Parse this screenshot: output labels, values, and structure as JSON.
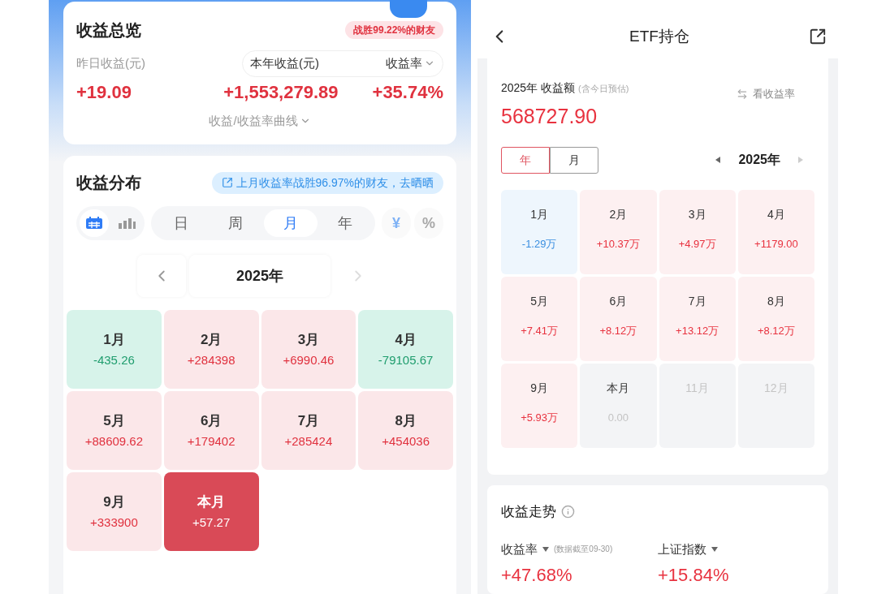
{
  "left": {
    "overview": {
      "title": "收益总览",
      "badge": "战胜99.22%的财友",
      "yesterday_label": "昨日收益(元)",
      "year_label": "本年收益(元)",
      "rate_label": "收益率",
      "yesterday_value": "+19.09",
      "year_value": "+1,553,279.89",
      "rate_value": "+35.74%",
      "curve_toggle": "收益/收益率曲线"
    },
    "distribution": {
      "title": "收益分布",
      "share_banner": "上月收益率战胜96.97%的财友，去晒晒",
      "views": [
        {
          "kind": "calendar",
          "selected": true
        },
        {
          "kind": "bars",
          "selected": false
        }
      ],
      "periods": [
        {
          "label": "日",
          "selected": false
        },
        {
          "label": "周",
          "selected": false
        },
        {
          "label": "月",
          "selected": true
        },
        {
          "label": "年",
          "selected": false
        }
      ],
      "units": [
        {
          "label": "¥",
          "selected": true
        },
        {
          "label": "%",
          "selected": false
        }
      ],
      "year": "2025年",
      "months": [
        {
          "label": "1月",
          "value": "-435.26",
          "kind": "loss"
        },
        {
          "label": "2月",
          "value": "+284398",
          "kind": "gain"
        },
        {
          "label": "3月",
          "value": "+6990.46",
          "kind": "gain"
        },
        {
          "label": "4月",
          "value": "-79105.67",
          "kind": "loss"
        },
        {
          "label": "5月",
          "value": "+88609.62",
          "kind": "gain"
        },
        {
          "label": "6月",
          "value": "+179402",
          "kind": "gain"
        },
        {
          "label": "7月",
          "value": "+285424",
          "kind": "gain"
        },
        {
          "label": "8月",
          "value": "+454036",
          "kind": "gain"
        },
        {
          "label": "9月",
          "value": "+333900",
          "kind": "gain"
        },
        {
          "label": "本月",
          "value": "+57.27",
          "kind": "current"
        }
      ]
    }
  },
  "right": {
    "header": {
      "title": "ETF持仓"
    },
    "summary": {
      "title": "2025年 收益额",
      "note": "(含今日预估)",
      "switch_label": "看收益率",
      "amount": "568727.90"
    },
    "tabs": [
      {
        "label": "年",
        "selected": true
      },
      {
        "label": "月",
        "selected": false
      }
    ],
    "year": "2025年",
    "months": [
      {
        "label": "1月",
        "value": "-1.29万",
        "kind": "loss"
      },
      {
        "label": "2月",
        "value": "+10.37万",
        "kind": "gain"
      },
      {
        "label": "3月",
        "value": "+4.97万",
        "kind": "gain"
      },
      {
        "label": "4月",
        "value": "+1179.00",
        "kind": "gain"
      },
      {
        "label": "5月",
        "value": "+7.41万",
        "kind": "gain"
      },
      {
        "label": "6月",
        "value": "+8.12万",
        "kind": "gain"
      },
      {
        "label": "7月",
        "value": "+13.12万",
        "kind": "gain"
      },
      {
        "label": "8月",
        "value": "+8.12万",
        "kind": "gain"
      },
      {
        "label": "9月",
        "value": "+5.93万",
        "kind": "gain"
      },
      {
        "label": "本月",
        "value": "0.00",
        "kind": "flat"
      },
      {
        "label": "11月",
        "kind": "future"
      },
      {
        "label": "12月",
        "kind": "future"
      }
    ],
    "trend": {
      "title": "收益走势",
      "metrics": [
        {
          "label": "收益率",
          "note": "(数据截至09-30)",
          "value": "+47.68%"
        },
        {
          "label": "上证指数",
          "value": "+15.84%"
        }
      ]
    }
  }
}
